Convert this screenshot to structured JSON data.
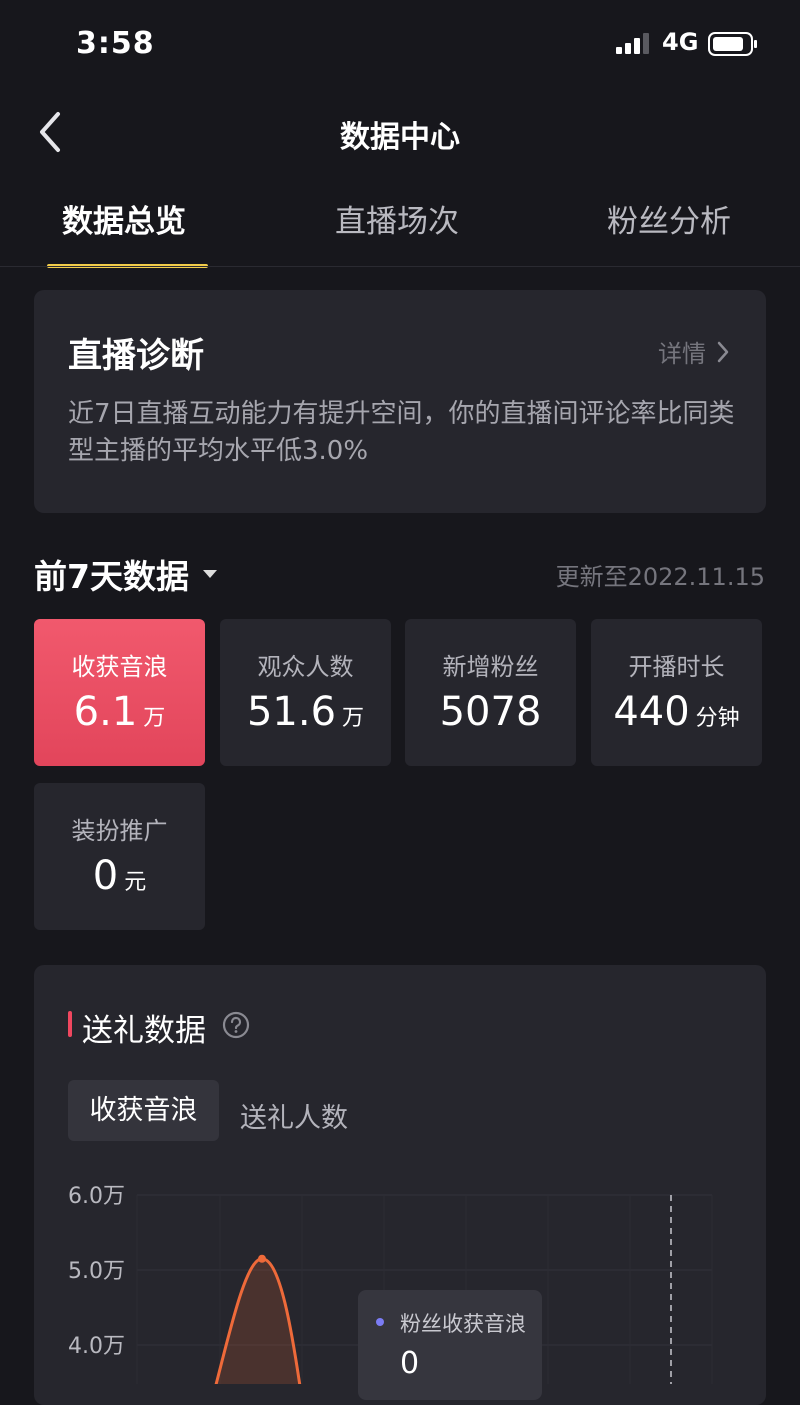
{
  "status_bar": {
    "time": "3:58",
    "network": "4G"
  },
  "nav": {
    "title": "数据中心"
  },
  "tabs": [
    {
      "label": "数据总览",
      "active": true
    },
    {
      "label": "直播场次",
      "active": false
    },
    {
      "label": "粉丝分析",
      "active": false
    }
  ],
  "diagnosis": {
    "title": "直播诊断",
    "detail_label": "详情",
    "text": "近7日直播互动能力有提升空间，你的直播间评论率比同类型主播的平均水平低3.0%"
  },
  "period": {
    "label": "前7天数据",
    "update": "更新至2022.11.15"
  },
  "metrics": [
    {
      "label": "收获音浪",
      "value": "6.1",
      "unit": "万",
      "highlight": true
    },
    {
      "label": "观众人数",
      "value": "51.6",
      "unit": "万"
    },
    {
      "label": "新增粉丝",
      "value": "5078",
      "unit": ""
    },
    {
      "label": "开播时长",
      "value": "440",
      "unit": "分钟"
    },
    {
      "label": "装扮推广",
      "value": "0",
      "unit": "元"
    }
  ],
  "gift": {
    "title": "送礼数据",
    "segments": [
      "收获音浪",
      "送礼人数"
    ],
    "tooltip": {
      "label": "粉丝收获音浪",
      "value": "0"
    }
  },
  "chart_data": {
    "type": "line",
    "y_ticks": [
      "6.0万",
      "5.0万",
      "4.0万"
    ],
    "ylim": [
      4.0,
      6.0
    ],
    "series": [
      {
        "name": "粉丝收获音浪",
        "peak_value": 5.15
      }
    ]
  },
  "colors": {
    "accent": "#f2cc4a",
    "highlight": "#ec4f64",
    "line": "#ee6a3a",
    "tooltip_dot": "#7b7cf4"
  }
}
